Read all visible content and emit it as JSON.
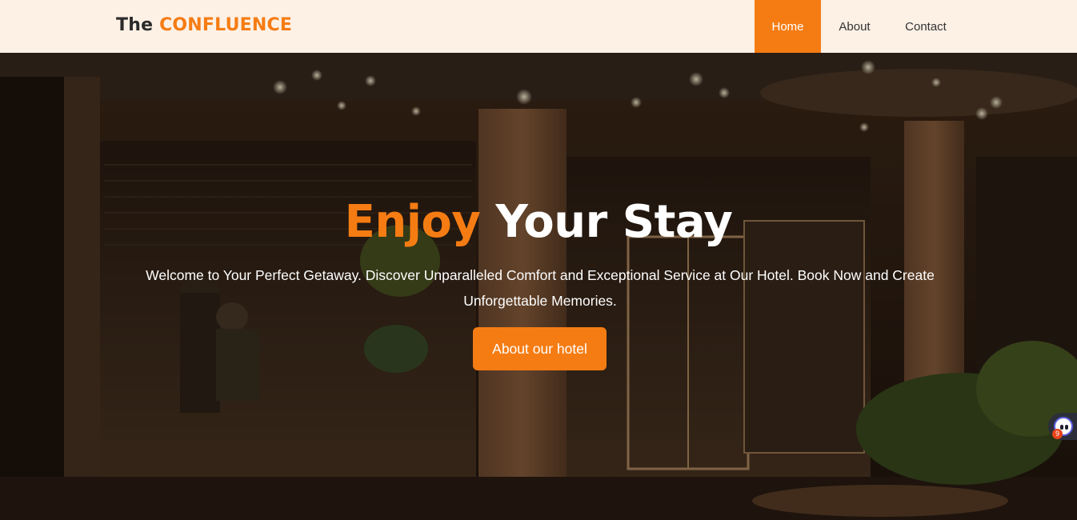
{
  "brand": {
    "prefix": "The",
    "accent": "CONFLUENCE"
  },
  "nav": {
    "items": [
      {
        "label": "Home",
        "active": true
      },
      {
        "label": "About",
        "active": false
      },
      {
        "label": "Contact",
        "active": false
      }
    ]
  },
  "hero": {
    "title_accent": "Enjoy",
    "title_rest": "Your Stay",
    "description": "Welcome to Your Perfect Getaway. Discover Unparalleled Comfort and Exceptional Service at Our Hotel. Book Now and Create Unforgettable Memories.",
    "cta_label": "About our hotel"
  },
  "widget": {
    "badge_count": "9",
    "icon": "chat-assistant-icon"
  },
  "colors": {
    "accent": "#f57c13",
    "navbar_bg": "#fdf1e6",
    "text_dark": "#2b2b2b"
  }
}
